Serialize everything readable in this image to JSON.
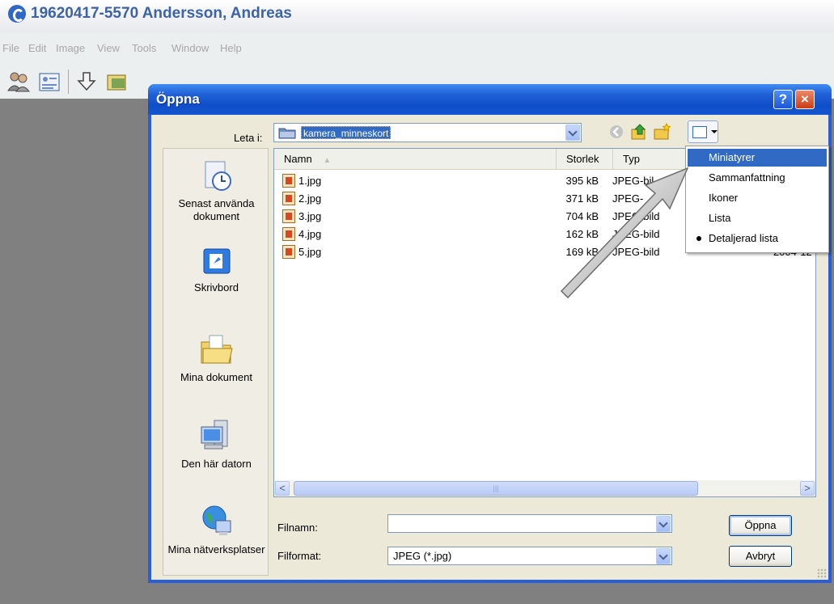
{
  "app": {
    "title": "19620417-5570 Andersson, Andreas",
    "menu": [
      "File",
      "Edit",
      "Image",
      "View",
      "Tools",
      "Window",
      "Help"
    ]
  },
  "dialog": {
    "title": "Öppna",
    "help_label": "?",
    "close_label": "×",
    "look_in_label": "Leta i:",
    "look_in_value": "kamera_minneskort",
    "places": [
      {
        "label": "Senast använda dokument",
        "icon": "recent-documents-icon"
      },
      {
        "label": "Skrivbord",
        "icon": "desktop-icon"
      },
      {
        "label": "Mina dokument",
        "icon": "my-documents-icon"
      },
      {
        "label": "Den här datorn",
        "icon": "my-computer-icon"
      },
      {
        "label": "Mina nätverksplatser",
        "icon": "network-places-icon"
      }
    ],
    "columns": {
      "name": "Namn",
      "size": "Storlek",
      "type": "Typ"
    },
    "files": [
      {
        "name": "1.jpg",
        "size": "395 kB",
        "type": "JPEG-bil",
        "date": ""
      },
      {
        "name": "2.jpg",
        "size": "371 kB",
        "type": "JPEG-",
        "date": ""
      },
      {
        "name": "3.jpg",
        "size": "704 kB",
        "type": "JPEG-bild",
        "date": ""
      },
      {
        "name": "4.jpg",
        "size": "162 kB",
        "type": "JPEG-bild",
        "date": ""
      },
      {
        "name": "5.jpg",
        "size": "169 kB",
        "type": "JPEG-bild",
        "date": "2004-12-"
      }
    ],
    "scroll_left": "<",
    "scroll_right": ">",
    "scroll_grip": "|||",
    "filename_label": "Filnamn:",
    "filename_value": "",
    "format_label": "Filformat:",
    "format_value": "JPEG (*.jpg)",
    "open_button": "Öppna",
    "cancel_button": "Avbryt"
  },
  "view_menu": {
    "items": [
      "Miniatyrer",
      "Sammanfattning",
      "Ikoner",
      "Lista",
      "Detaljerad lista"
    ],
    "selected": "Miniatyrer",
    "checked": "Detaljerad lista"
  },
  "colors": {
    "titlebar_blue": "#0f4ec9",
    "selection_blue": "#316ac5",
    "dialog_face": "#ece9d8"
  }
}
